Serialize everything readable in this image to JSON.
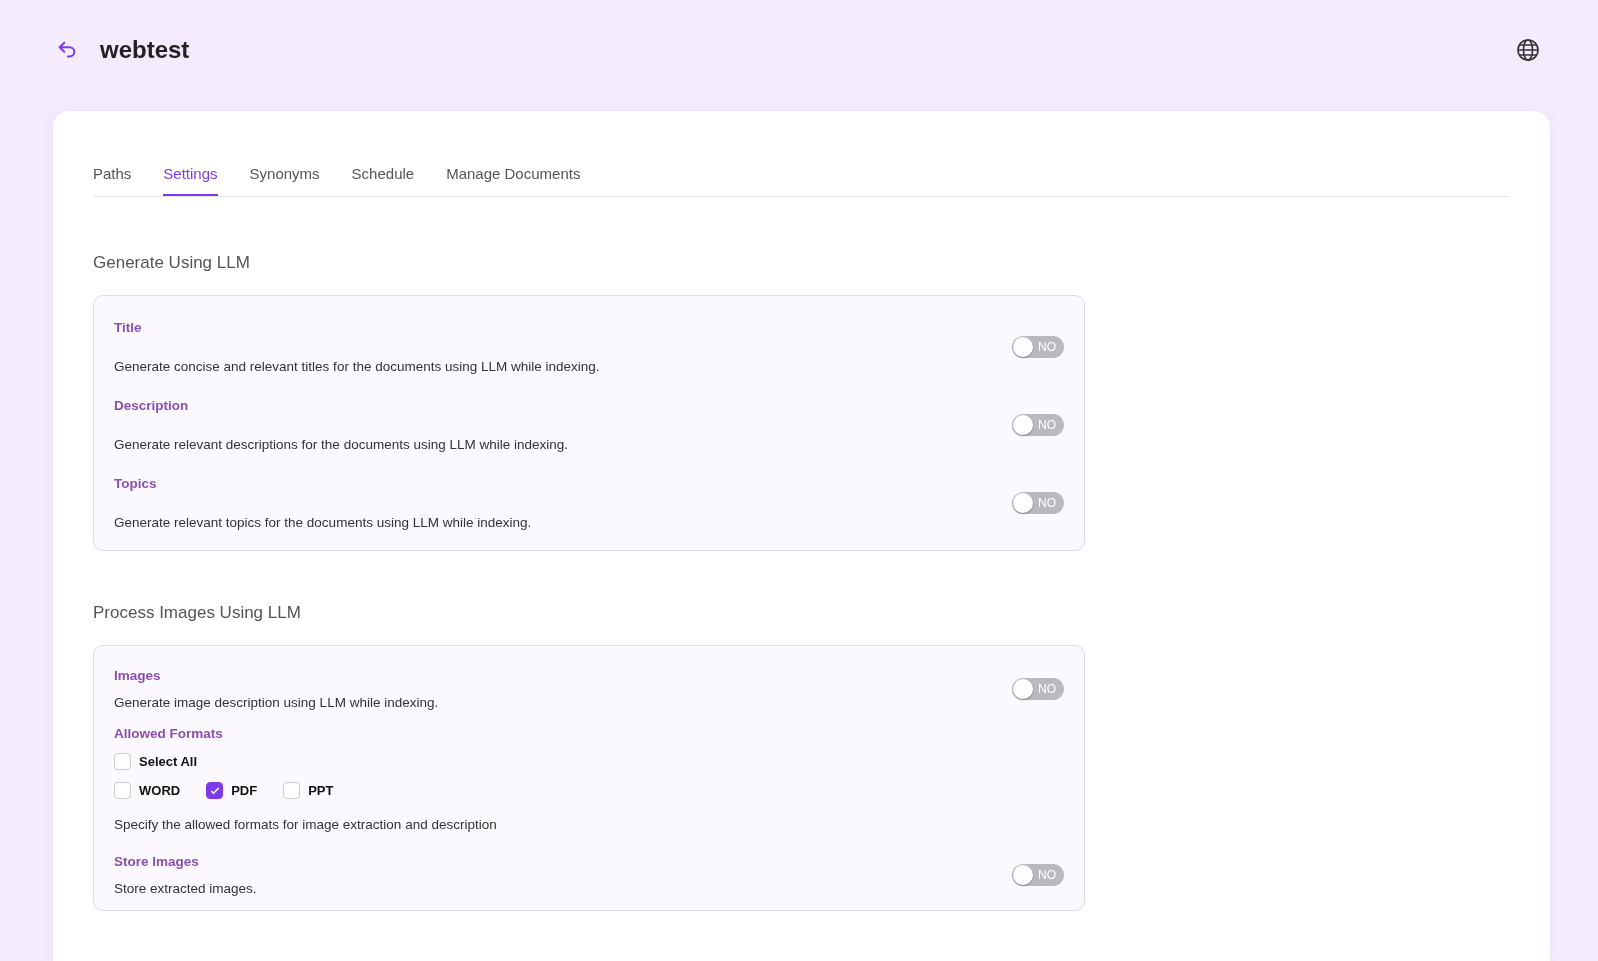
{
  "header": {
    "title": "webtest"
  },
  "tabs": [
    {
      "label": "Paths",
      "selected": false
    },
    {
      "label": "Settings",
      "selected": true
    },
    {
      "label": "Synonyms",
      "selected": false
    },
    {
      "label": "Schedule",
      "selected": false
    },
    {
      "label": "Manage Documents",
      "selected": false
    }
  ],
  "sections": [
    {
      "heading": "Generate Using LLM",
      "items": [
        {
          "kind": "toggle",
          "title": "Title",
          "description": "Generate concise and relevant titles for the documents using LLM while indexing.",
          "on": false,
          "toggle_label": "NO"
        },
        {
          "kind": "toggle",
          "title": "Description",
          "description": "Generate relevant descriptions for the documents using LLM while indexing.",
          "on": false,
          "toggle_label": "NO"
        },
        {
          "kind": "toggle",
          "title": "Topics",
          "description": "Generate relevant topics for the documents using LLM while indexing.",
          "on": false,
          "toggle_label": "NO"
        }
      ]
    },
    {
      "heading": "Process Images Using LLM",
      "items": [
        {
          "kind": "inline_toggle",
          "title": "Images",
          "description": "Generate image description using LLM while indexing.",
          "on": false,
          "toggle_label": "NO"
        },
        {
          "kind": "formats",
          "title": "Allowed Formats",
          "select_all": {
            "label": "Select All",
            "checked": false
          },
          "options": [
            {
              "label": "WORD",
              "checked": false
            },
            {
              "label": "PDF",
              "checked": true
            },
            {
              "label": "PPT",
              "checked": false
            }
          ],
          "description": "Specify the allowed formats for image extraction and description"
        },
        {
          "kind": "inline_toggle",
          "title": "Store Images",
          "description": "Store extracted images.",
          "on": false,
          "toggle_label": "NO"
        }
      ]
    }
  ]
}
